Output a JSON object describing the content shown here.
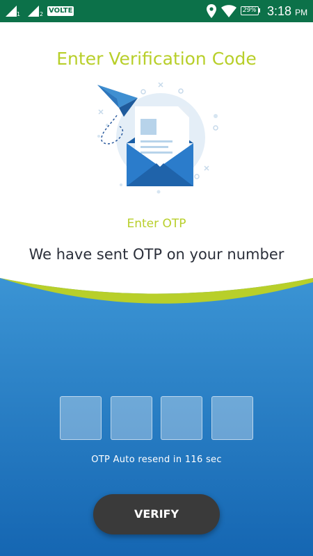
{
  "status_bar": {
    "sim1": "1",
    "sim2": "2",
    "volte": "VOLTE",
    "battery": "29%",
    "time": "3:18",
    "ampm": "PM",
    "icons": [
      "signal-icon",
      "signal-icon",
      "location-icon",
      "wifi-icon",
      "battery-icon"
    ]
  },
  "header": {
    "title": "Enter Verification Code"
  },
  "content": {
    "otp_heading": "Enter OTP",
    "message": "We have sent OTP on your number"
  },
  "otp": {
    "box_count": 4,
    "resend_text": "OTP Auto resend in 116 sec"
  },
  "actions": {
    "verify_label": "VERIFY"
  },
  "colors": {
    "status_bar": "#0c7149",
    "accent": "#b8cf2a",
    "panel_top": "#3b94d4",
    "panel_bottom": "#1566b2",
    "button": "#3a3a3a"
  }
}
